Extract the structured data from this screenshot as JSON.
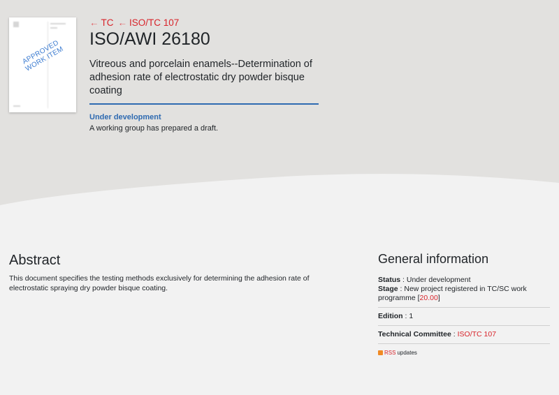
{
  "breadcrumbs": [
    {
      "arrow": "←",
      "label": "TC"
    },
    {
      "arrow": "←",
      "label": "ISO/TC 107"
    }
  ],
  "document": {
    "title": "ISO/AWI 26180",
    "subtitle": "Vitreous and porcelain enamels--Determination of adhesion rate of electrostatic dry powder bisque coating",
    "stamp": "APPROVED WORK ITEM",
    "status_label": "Under development",
    "status_description": "A working group has prepared a draft."
  },
  "abstract": {
    "heading": "Abstract",
    "text": "This document specifies the testing methods exclusively for determining the adhesion rate of electrostatic spraying dry powder bisque coating."
  },
  "general_info": {
    "heading": "General information",
    "status_key": "Status",
    "status_value": "Under development",
    "stage_key": "Stage",
    "stage_value": "New project registered in TC/SC work programme",
    "stage_code": "20.00",
    "edition_key": "Edition",
    "edition_value": "1",
    "tc_key": "Technical Committee",
    "tc_value": "ISO/TC 107",
    "rss_label": "RSS",
    "rss_suffix": "updates"
  },
  "colors": {
    "accent_red": "#d8232a",
    "accent_blue": "#2e6ab1",
    "hero_gray": "#e2e1df",
    "page_gray": "#f2f2f2"
  },
  "icons": {
    "breadcrumb_arrow": "left-arrow-icon",
    "rss": "rss-icon"
  }
}
